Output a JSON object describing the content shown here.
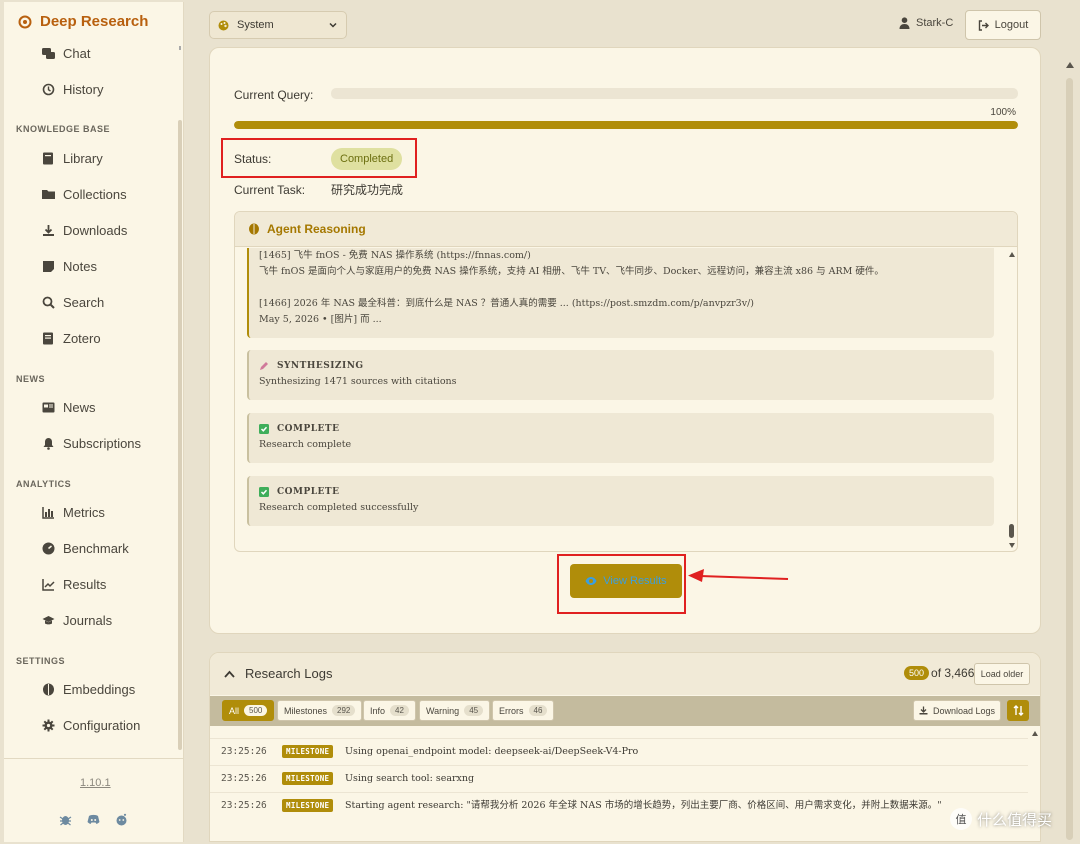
{
  "brand": {
    "title": "Deep Research"
  },
  "sidebar": {
    "top_items": [
      {
        "label": "Chat",
        "icon": "chat-icon"
      },
      {
        "label": "History",
        "icon": "history-icon"
      }
    ],
    "sections": [
      {
        "title": "KNOWLEDGE BASE",
        "items": [
          {
            "label": "Library",
            "icon": "book-icon"
          },
          {
            "label": "Collections",
            "icon": "folder-icon"
          },
          {
            "label": "Downloads",
            "icon": "download-icon"
          },
          {
            "label": "Notes",
            "icon": "note-icon"
          },
          {
            "label": "Search",
            "icon": "search-icon"
          },
          {
            "label": "Zotero",
            "icon": "zotero-book-icon"
          }
        ]
      },
      {
        "title": "NEWS",
        "items": [
          {
            "label": "News",
            "icon": "newspaper-icon"
          },
          {
            "label": "Subscriptions",
            "icon": "bell-icon"
          }
        ]
      },
      {
        "title": "ANALYTICS",
        "items": [
          {
            "label": "Metrics",
            "icon": "bar-chart-icon"
          },
          {
            "label": "Benchmark",
            "icon": "gauge-icon"
          },
          {
            "label": "Results",
            "icon": "line-chart-icon"
          },
          {
            "label": "Journals",
            "icon": "graduation-cap-icon"
          }
        ]
      },
      {
        "title": "SETTINGS",
        "items": [
          {
            "label": "Embeddings",
            "icon": "brain-icon"
          },
          {
            "label": "Configuration",
            "icon": "gear-icon"
          }
        ]
      }
    ],
    "version": "1.10.1",
    "footer_icons": [
      "bug-icon",
      "discord-icon",
      "reddit-icon"
    ]
  },
  "header": {
    "theme_select": "System",
    "user": "Stark-C",
    "logout": "Logout"
  },
  "research": {
    "query_label": "Current Query:",
    "progress_pct_text": "100%",
    "progress": 1.0,
    "status_label": "Status:",
    "status_value": "Completed",
    "task_label": "Current Task:",
    "task_value": "研究成功完成",
    "reasoning_title": "Agent Reasoning",
    "reasoning_first": {
      "line1": "[1465] 飞牛 fnOS - 免费 NAS 操作系统 (https://fnnas.com/)",
      "line2": "飞牛 fnOS 是面向个人与家庭用户的免费 NAS 操作系统，支持 AI 相册、飞牛 TV、飞牛同步、Docker、远程访问，兼容主流 x86 与 ARM 硬件。",
      "line3": "[1466] 2026 年 NAS 最全科普：到底什么是 NAS ？普通人真的需要 ... (https://post.smzdm.com/p/anvpzr3v/)",
      "line4": "May 5, 2026 • [图片] 而 ..."
    },
    "reasoning_blocks": [
      {
        "title": "SYNTHESIZING",
        "icon": "pencil-icon",
        "text": "Synthesizing 1471 sources with citations"
      },
      {
        "title": "COMPLETE",
        "icon": "check-icon",
        "text": "Research complete"
      },
      {
        "title": "COMPLETE",
        "icon": "check-icon",
        "text": "Research completed successfully"
      }
    ],
    "view_results": "View Results"
  },
  "logs": {
    "title": "Research Logs",
    "shown": "500",
    "total_text": "of 3,466",
    "load_older": "Load older",
    "filters": [
      {
        "label": "All",
        "count": "500"
      },
      {
        "label": "Milestones",
        "count": "292"
      },
      {
        "label": "Info",
        "count": "42"
      },
      {
        "label": "Warning",
        "count": "45"
      },
      {
        "label": "Errors",
        "count": "46"
      }
    ],
    "download": "Download Logs",
    "rows": [
      {
        "time": "23:25:26",
        "tag": "MILESTONE",
        "msg": "Using openai_endpoint model: deepseek-ai/DeepSeek-V4-Pro"
      },
      {
        "time": "23:25:26",
        "tag": "MILESTONE",
        "msg": "Using search tool: searxng"
      },
      {
        "time": "23:25:26",
        "tag": "MILESTONE",
        "msg": "Starting agent research: \"请帮我分析 2026 年全球 NAS 市场的增长趋势，列出主要厂商、价格区间、用户需求变化，并附上数据来源。\""
      }
    ]
  },
  "watermark": {
    "text": "什么值得买",
    "mark": "值"
  },
  "colors": {
    "accent": "#b08d0a",
    "brand": "#b8600f",
    "highlight": "#e02020"
  }
}
